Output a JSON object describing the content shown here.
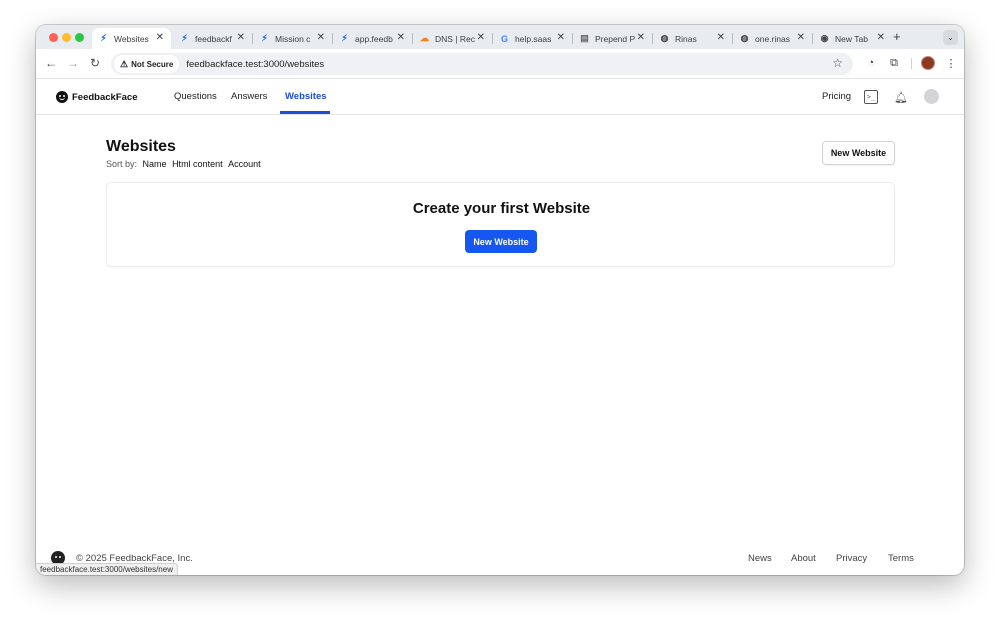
{
  "browser": {
    "tabs": [
      {
        "title": "Websites",
        "icon": "bolt-icon",
        "active": true
      },
      {
        "title": "feedbackf",
        "icon": "bolt-icon",
        "active": false
      },
      {
        "title": "Mission c",
        "icon": "bolt-icon",
        "active": false
      },
      {
        "title": "app.feedb",
        "icon": "bolt-icon",
        "active": false
      },
      {
        "title": "DNS | Rec",
        "icon": "cloud-icon",
        "active": false
      },
      {
        "title": "help.saas",
        "icon": "google-icon",
        "active": false
      },
      {
        "title": "Prepend P",
        "icon": "book-icon",
        "active": false
      },
      {
        "title": "Rinas",
        "icon": "globe-icon",
        "active": false
      },
      {
        "title": "one.rinas",
        "icon": "globe-icon",
        "active": false
      },
      {
        "title": "New Tab",
        "icon": "chrome-icon",
        "active": false
      }
    ],
    "security_badge": "Not Secure",
    "url": "feedbackface.test:3000/websites",
    "status_url": "feedbackface.test:3000/websites/new"
  },
  "nav": {
    "brand": "FeedbackFace",
    "links": [
      {
        "label": "Questions",
        "active": false
      },
      {
        "label": "Answers",
        "active": false
      },
      {
        "label": "Websites",
        "active": true
      }
    ],
    "pricing": "Pricing"
  },
  "main": {
    "title": "Websites",
    "sort_label": "Sort by:",
    "sort_options": [
      "Name",
      "Html content",
      "Account"
    ],
    "new_button": "New Website",
    "empty_title": "Create your first Website",
    "empty_button": "New Website"
  },
  "footer": {
    "copyright": "© 2025 FeedbackFace, Inc.",
    "links": [
      "News",
      "About",
      "Privacy",
      "Terms"
    ]
  },
  "colors": {
    "accent": "#1d4ed8",
    "primary_button": "#1557f0"
  }
}
